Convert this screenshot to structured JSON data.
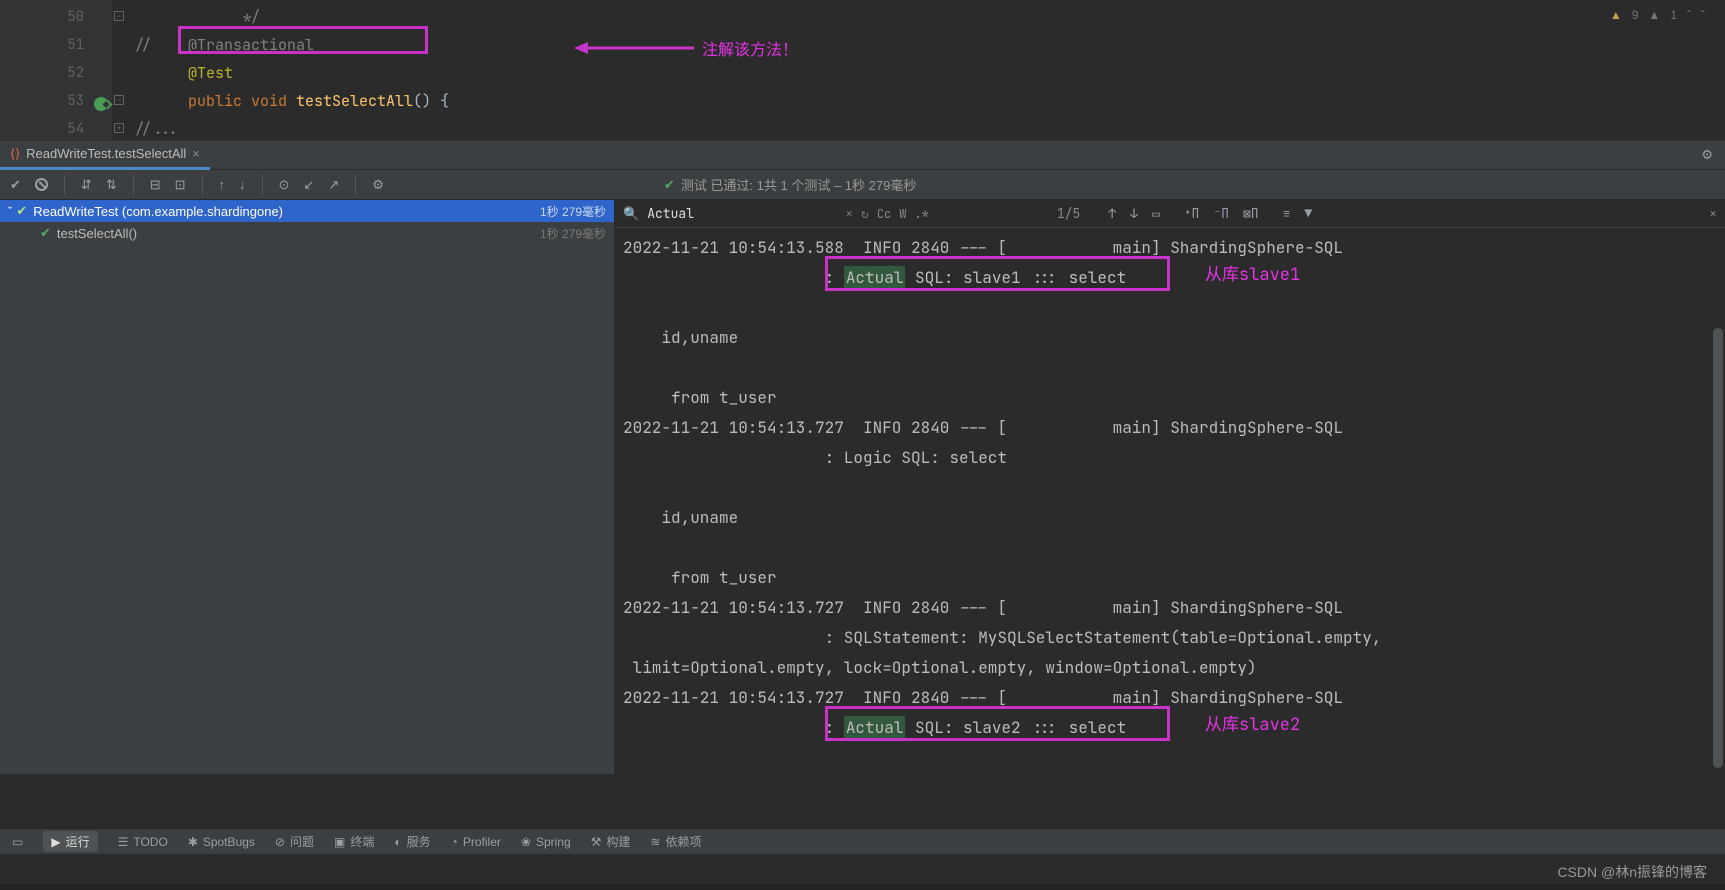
{
  "editor": {
    "lines": [
      50,
      51,
      52,
      53,
      54
    ],
    "l50": "*/",
    "l51_pre": "//    ",
    "l51_ann": "@Transactional",
    "l52": "@Test",
    "l53_kw": "public void ",
    "l53_fn": "testSelectAll",
    "l53_end": "() {",
    "l54": "//...",
    "annot_label": "注解该方法！"
  },
  "warnings": {
    "w1": "9",
    "w2": "1"
  },
  "runtab": {
    "title": "ReadWriteTest.testSelectAll"
  },
  "toolbar_status": "测试 已通过: 1共 1 个测试 – 1秒 279毫秒",
  "tree": {
    "row1": {
      "name": "ReadWriteTest (com.example.shardingone)",
      "time": "1秒 279毫秒"
    },
    "row2": {
      "name": "testSelectAll()",
      "time": "1秒 279毫秒"
    }
  },
  "search": {
    "value": "Actual",
    "count": "1/5",
    "cc": "Cc",
    "w": "W",
    "re": ".*"
  },
  "console": {
    "l1": "2022-11-21 10:54:13.588  INFO 2840 --- [           main] ShardingSphere-SQL",
    "l2_pre": "                     : ",
    "l2_hl": "Actual",
    "l2_post": " SQL: slave1 ::: select ",
    "l3": "",
    "l4": "    id,uname",
    "l5": "",
    "l6": "     from t_user",
    "l7": "2022-11-21 10:54:13.727  INFO 2840 --- [           main] ShardingSphere-SQL",
    "l8": "                     : Logic SQL: select ",
    "l9": "",
    "l10": "    id,uname",
    "l11": "",
    "l12": "     from t_user",
    "l13": "2022-11-21 10:54:13.727  INFO 2840 --- [           main] ShardingSphere-SQL",
    "l14": "                     : SQLStatement: MySQLSelectStatement(table=Optional.empty,",
    "l15": " limit=Optional.empty, lock=Optional.empty, window=Optional.empty)",
    "l16": "2022-11-21 10:54:13.727  INFO 2840 --- [           main] ShardingSphere-SQL",
    "l17_pre": "                     : ",
    "l17_hl": "Actual",
    "l17_post": " SQL: slave2 ::: select ",
    "slave1_label": "从库slave1",
    "slave2_label": "从库slave2"
  },
  "bottombar": {
    "run": "运行",
    "todo": "TODO",
    "spotbugs": "SpotBugs",
    "problems": "问题",
    "terminal": "终端",
    "services": "服务",
    "profiler": "Profiler",
    "spring": "Spring",
    "build": "构建",
    "deps": "依赖项"
  },
  "footer": "CSDN @林n振锋的博客"
}
